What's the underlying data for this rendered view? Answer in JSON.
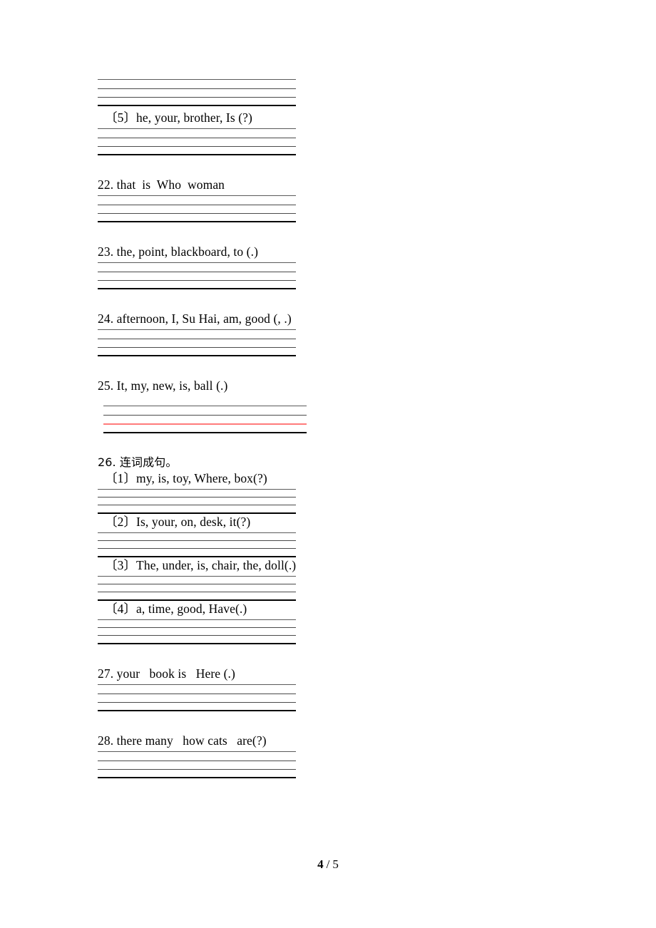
{
  "document": {
    "footer": {
      "current_page": "4",
      "separator": "/",
      "total_pages": "5"
    }
  },
  "items": [
    {
      "id": "item-5",
      "label": "〔5〕he, your, brother, Is (?)"
    },
    {
      "id": "item-22",
      "label": "22. that  is  Who  woman"
    },
    {
      "id": "item-23",
      "label": "23. the, point, blackboard, to (.)"
    },
    {
      "id": "item-24",
      "label": "24. afternoon, I, Su Hai, am, good (, .)"
    },
    {
      "id": "item-25",
      "label": "25. It, my, new, is, ball (.)"
    },
    {
      "id": "item-26",
      "label": "26. 连词成句。",
      "subitems": [
        {
          "id": "item-26-1",
          "label": "〔1〕my, is, toy, Where, box(?)"
        },
        {
          "id": "item-26-2",
          "label": "〔2〕Is, your, on, desk, it(?)"
        },
        {
          "id": "item-26-3",
          "label": "〔3〕The, under, is, chair, the, doll(.)"
        },
        {
          "id": "item-26-4",
          "label": "〔4〕a, time, good, Have(.)"
        }
      ]
    },
    {
      "id": "item-27",
      "label": "27. your   book is   Here (.)"
    },
    {
      "id": "item-28",
      "label": "28. there many   how cats   are(?)"
    }
  ],
  "colors": {
    "rule_dark": "#4a4a4a",
    "rule_bold": "#000000",
    "rule_red": "#ff7b7b",
    "text": "#000000",
    "background": "#ffffff"
  }
}
